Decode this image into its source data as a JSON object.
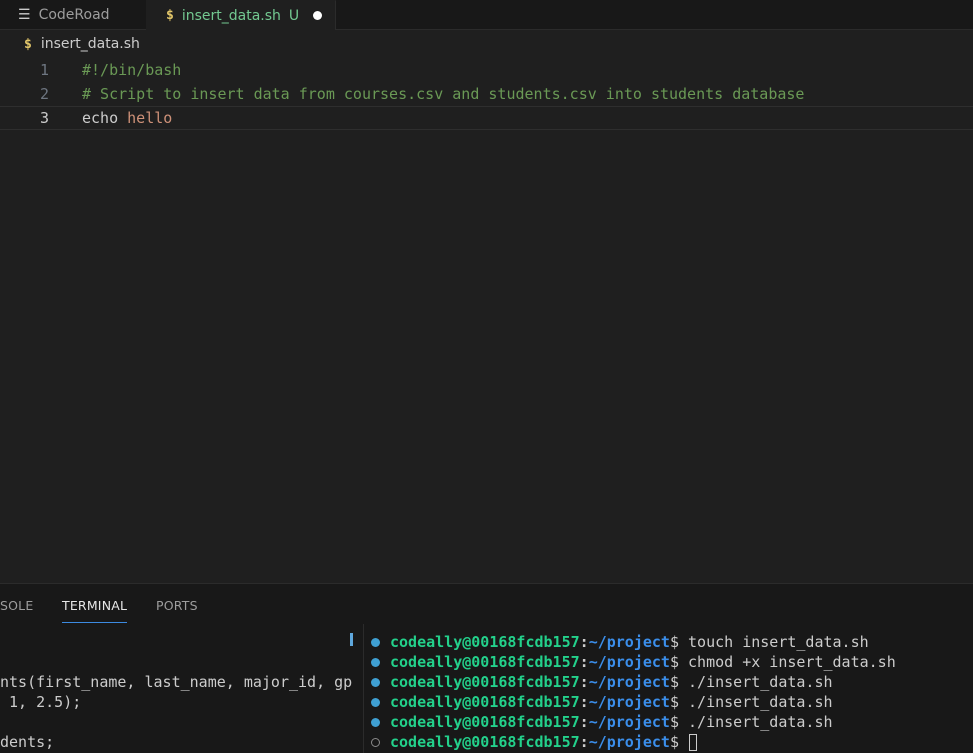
{
  "tabs": [
    {
      "label": "CodeRoad",
      "icon": "list-icon"
    },
    {
      "label": "insert_data.sh",
      "icon": "dollar-icon",
      "badge": "U",
      "modified": true
    }
  ],
  "breadcrumb": {
    "icon": "dollar-icon",
    "label": "insert_data.sh"
  },
  "editor": {
    "lines": [
      {
        "number": "1",
        "text": "#!/bin/bash"
      },
      {
        "number": "2",
        "text": "# Script to insert data from courses.csv and students.csv into students database"
      },
      {
        "number": "3",
        "keyword": "echo",
        "arg": "hello"
      }
    ]
  },
  "panel": {
    "tabs": [
      "SOLE",
      "TERMINAL",
      "PORTS"
    ],
    "left_terminal": [
      "nts(first_name, last_name, major_id, gp",
      " 1, 2.5);",
      "",
      "dents;"
    ],
    "terminal": {
      "user": "codeally@00168fcdb157",
      "path": "~/project",
      "commands": [
        "touch insert_data.sh",
        "chmod +x insert_data.sh",
        "./insert_data.sh",
        "./insert_data.sh",
        "./insert_data.sh",
        ""
      ]
    }
  },
  "colors": {
    "accent": "#3c8ae0",
    "user": "#23d18b",
    "path": "#3b8eea",
    "comment": "#6a9955",
    "string": "#ce9178"
  }
}
